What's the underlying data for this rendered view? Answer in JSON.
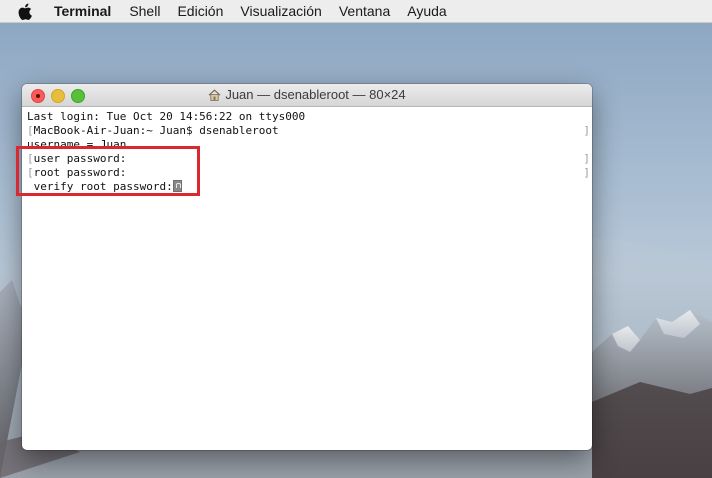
{
  "menubar": {
    "apple_icon": "apple-icon",
    "app_name": "Terminal",
    "items": [
      "Shell",
      "Edición",
      "Visualización",
      "Ventana",
      "Ayuda"
    ]
  },
  "window": {
    "title": "Juan — dsenableroot — 80×24",
    "title_icon": "home-icon",
    "traffic_colors": {
      "close": "#fc5b57",
      "minimize": "#e5bf3c",
      "maximize": "#57c038"
    }
  },
  "terminal": {
    "lines": [
      "Last login: Tue Oct 20 14:56:22 on ttys000",
      "MacBook-Air-Juan:~ Juan$ dsenableroot",
      "username = Juan",
      "user password:",
      "root password:",
      "verify root password:"
    ],
    "cursor_icon": "key-cursor-icon"
  },
  "annotation": {
    "color": "#d9282f"
  }
}
